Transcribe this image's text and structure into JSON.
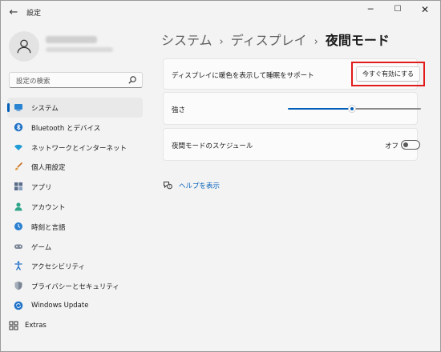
{
  "window": {
    "title": "設定",
    "back_icon": "back-arrow-icon",
    "controls": {
      "minimize": "─",
      "maximize": "☐",
      "close": "✕"
    }
  },
  "sidebar": {
    "search_placeholder": "設定の検索",
    "items": [
      {
        "label": "システム",
        "icon": "monitor-icon",
        "selected": true
      },
      {
        "label": "Bluetooth とデバイス",
        "icon": "bluetooth-icon",
        "selected": false
      },
      {
        "label": "ネットワークとインターネット",
        "icon": "wifi-icon",
        "selected": false
      },
      {
        "label": "個人用設定",
        "icon": "paintbrush-icon",
        "selected": false
      },
      {
        "label": "アプリ",
        "icon": "apps-icon",
        "selected": false
      },
      {
        "label": "アカウント",
        "icon": "account-icon",
        "selected": false
      },
      {
        "label": "時刻と言語",
        "icon": "clock-globe-icon",
        "selected": false
      },
      {
        "label": "ゲーム",
        "icon": "gamepad-icon",
        "selected": false
      },
      {
        "label": "アクセシビリティ",
        "icon": "accessibility-icon",
        "selected": false
      },
      {
        "label": "プライバシーとセキュリティ",
        "icon": "shield-icon",
        "selected": false
      },
      {
        "label": "Windows Update",
        "icon": "windows-update-icon",
        "selected": false
      },
      {
        "label": "Extras",
        "icon": "extras-grid-icon",
        "selected": false
      }
    ]
  },
  "main": {
    "breadcrumb": {
      "part1": "システム",
      "sep": "›",
      "part2": "ディスプレイ",
      "current": "夜間モード"
    },
    "card_bluelight": {
      "label": "ディスプレイに暖色を表示して睡眠をサポート",
      "button": "今すぐ有効にする"
    },
    "card_strength": {
      "label": "強さ",
      "value_fraction": 0.48
    },
    "card_schedule": {
      "label": "夜間モードのスケジュール",
      "toggle_state": "オフ",
      "toggle_on": false
    },
    "help": {
      "label": "ヘルプを表示"
    }
  },
  "colors": {
    "accent": "#005fb8",
    "highlight_box": "#e21a1a",
    "background": "#f3f3f3",
    "card": "#fbfbfb"
  }
}
